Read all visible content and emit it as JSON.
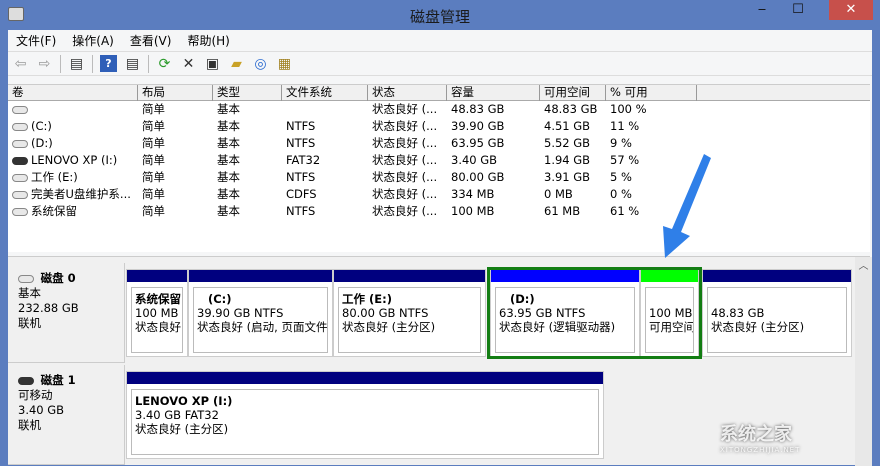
{
  "window": {
    "title": "磁盘管理",
    "minimize": "‒",
    "maximize": "☐",
    "close": "✕"
  },
  "menu": [
    "文件(F)",
    "操作(A)",
    "查看(V)",
    "帮助(H)"
  ],
  "table": {
    "columns": [
      "卷",
      "布局",
      "类型",
      "文件系统",
      "状态",
      "容量",
      "可用空间",
      "% 可用"
    ],
    "rows": [
      [
        "",
        "简单",
        "基本",
        "",
        "状态良好 (...",
        "48.83 GB",
        "48.83 GB",
        "100 %"
      ],
      [
        "(C:)",
        "简单",
        "基本",
        "NTFS",
        "状态良好 (...",
        "39.90 GB",
        "4.51 GB",
        "11 %"
      ],
      [
        "(D:)",
        "简单",
        "基本",
        "NTFS",
        "状态良好 (...",
        "63.95 GB",
        "5.52 GB",
        "9 %"
      ],
      [
        "LENOVO XP (I:)",
        "简单",
        "基本",
        "FAT32",
        "状态良好 (...",
        "3.40 GB",
        "1.94 GB",
        "57 %"
      ],
      [
        "工作 (E:)",
        "简单",
        "基本",
        "NTFS",
        "状态良好 (...",
        "80.00 GB",
        "3.91 GB",
        "5 %"
      ],
      [
        "完美者U盘维护系...",
        "简单",
        "基本",
        "CDFS",
        "状态良好 (...",
        "334 MB",
        "0 MB",
        "0 %"
      ],
      [
        "系统保留",
        "简单",
        "基本",
        "NTFS",
        "状态良好 (...",
        "100 MB",
        "61 MB",
        "61 %"
      ]
    ]
  },
  "disks": [
    {
      "name": "磁盘 0",
      "type": "基本",
      "size": "232.88 GB",
      "status": "联机",
      "partitions": [
        {
          "title": "系统保留",
          "line1": "100 MB",
          "line2": "状态良好"
        },
        {
          "title": "(C:)",
          "line1": "39.90 GB NTFS",
          "line2": "状态良好 (启动, 页面文件"
        },
        {
          "title": "工作  (E:)",
          "line1": "80.00 GB NTFS",
          "line2": "状态良好 (主分区)"
        },
        {
          "title": "(D:)",
          "line1": "63.95 GB NTFS",
          "line2": "状态良好 (逻辑驱动器)"
        },
        {
          "title": "",
          "line1": "100 MB",
          "line2": "可用空间"
        },
        {
          "title": "",
          "line1": "48.83 GB",
          "line2": "状态良好 (主分区)"
        }
      ]
    },
    {
      "name": "磁盘 1",
      "type": "可移动",
      "size": "3.40 GB",
      "status": "联机",
      "partitions": [
        {
          "title": "LENOVO XP  (I:)",
          "line1": "3.40 GB FAT32",
          "line2": "状态良好 (主分区)"
        }
      ]
    }
  ],
  "colors": {
    "primary": "#00007f",
    "logical": "#0000ff",
    "free": "#00ff00",
    "selected": "#137d13"
  },
  "watermark": {
    "text": "系统之家",
    "sub": "XITONGZHIJIA.NET"
  }
}
